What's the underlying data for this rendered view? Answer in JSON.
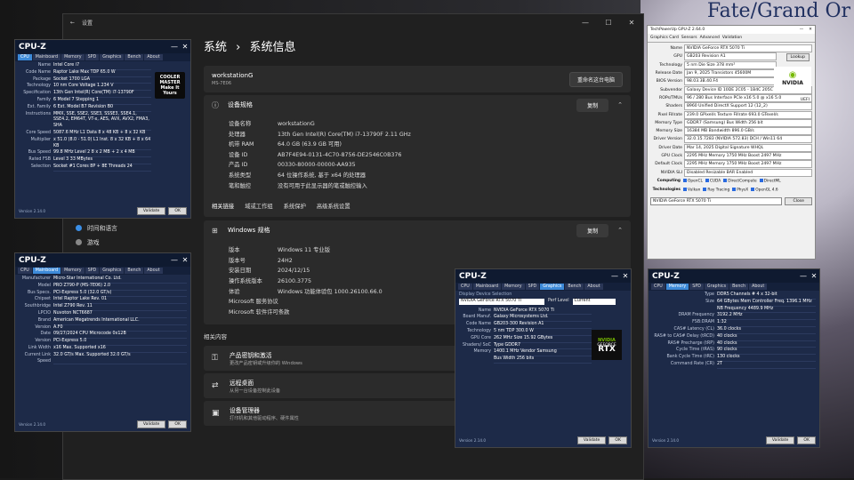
{
  "background": {
    "brand_text": "Fate/Grand Or"
  },
  "settings": {
    "window_title": "设置",
    "header": {
      "parent": "系统",
      "separator": "›",
      "current": "系统信息"
    },
    "device": {
      "name": "workstationG",
      "model": "MS-7E06",
      "rename_button": "重命名这台电脑"
    },
    "spec_section": {
      "title": "设备规格",
      "copy_button": "复制",
      "rows": [
        {
          "k": "设备名称",
          "v": "workstationG"
        },
        {
          "k": "处理器",
          "v": "13th Gen Intel(R) Core(TM) i7-13790F   2.11 GHz"
        },
        {
          "k": "机带 RAM",
          "v": "64.0 GB (63.9 GB 可用)"
        },
        {
          "k": "设备 ID",
          "v": "AB7F4E94-0131-4C70-8756-DE2546C0B376"
        },
        {
          "k": "产品 ID",
          "v": "00330-80000-00000-AA935"
        },
        {
          "k": "系统类型",
          "v": "64 位操作系统, 基于 x64 的处理器"
        },
        {
          "k": "笔和触控",
          "v": "没有可用于此显示器的笔或触控输入"
        }
      ],
      "related_links": [
        "相关链接",
        "域或工作组",
        "系统保护",
        "高级系统设置"
      ]
    },
    "windows_section": {
      "title": "Windows 规格",
      "copy_button": "复制",
      "rows": [
        {
          "k": "版本",
          "v": "Windows 11 专业版"
        },
        {
          "k": "版本号",
          "v": "24H2"
        },
        {
          "k": "安装日期",
          "v": "2024/12/15"
        },
        {
          "k": "操作系统版本",
          "v": "26100.3775"
        },
        {
          "k": "体验",
          "v": "Windows 功能体验包 1000.26100.66.0"
        }
      ],
      "links": [
        "Microsoft 服务协议",
        "Microsoft 软件许可条款"
      ]
    },
    "related_title": "相关内容",
    "related_items": [
      {
        "title": "产品密钥和激活",
        "desc": "更改产品密钥或升级你的 Windows"
      },
      {
        "title": "远程桌面",
        "desc": "从另一台设备控制此设备"
      },
      {
        "title": "设备管理器",
        "desc": "打印机和其他驱动程序、硬件属性"
      }
    ],
    "sidebar_visible": [
      "时间和语言",
      "游戏"
    ]
  },
  "cpuz_cpu": {
    "title": "CPU-Z",
    "tabs": [
      "CPU",
      "Mainboard",
      "Memory",
      "SPD",
      "Graphics",
      "Bench",
      "About"
    ],
    "active_tab": "CPU",
    "logo_text": "COOLER MASTER Make It Yours",
    "rows": [
      {
        "k": "Name",
        "v": "Intel Core i7"
      },
      {
        "k": "Code Name",
        "v": "Raptor Lake    Max TDP  65.0 W"
      },
      {
        "k": "Package",
        "v": "Socket 1700 LGA"
      },
      {
        "k": "Technology",
        "v": "10 nm    Core Voltage  1.234 V"
      },
      {
        "k": "Specification",
        "v": "13th Gen Intel(R) Core(TM) i7-13790F"
      },
      {
        "k": "Family",
        "v": "6    Model 7    Stepping 1"
      },
      {
        "k": "Ext. Family",
        "v": "6    Ext. Model B7    Revision B0"
      },
      {
        "k": "Instructions",
        "v": "MMX, SSE, SSE2, SSE3, SSSE3, SSE4.1, SSE4.2, EM64T, VT-x, AES, AVX, AVX2, FMA3, SHA"
      },
      {
        "k": "Core Speed",
        "v": "5087.6 MHz   L1 Data 8 x 48 KB + 8 x 32 KB"
      },
      {
        "k": "Multiplier",
        "v": "x 51.0 (8.0 - 51.0)   L1 Inst. 8 x 32 KB + 8 x 64 KB"
      },
      {
        "k": "Bus Speed",
        "v": "99.8 MHz   Level 2  8 x 2 MB + 2 x 4 MB"
      },
      {
        "k": "Rated FSB",
        "v": "Level 3  33 MBytes"
      },
      {
        "k": "Selection",
        "v": "Socket #1   Cores 8P + 8E   Threads 24"
      }
    ],
    "version": "Version 2.14.0",
    "validate": "Validate",
    "ok": "OK"
  },
  "cpuz_mainboard": {
    "title": "CPU-Z",
    "tabs": [
      "CPU",
      "Mainboard",
      "Memory",
      "SPD",
      "Graphics",
      "Bench",
      "About"
    ],
    "active_tab": "Mainboard",
    "rows": [
      {
        "k": "Manufacturer",
        "v": "Micro-Star International Co. Ltd."
      },
      {
        "k": "Model",
        "v": "PRO Z790-P (MS-7E06)   2.0"
      },
      {
        "k": "Bus Specs.",
        "v": "PCI-Express 5.0 (32.0 GT/s)"
      },
      {
        "k": "Chipset",
        "v": "Intel   Raptor Lake   Rev. 01"
      },
      {
        "k": "Southbridge",
        "v": "Intel   Z790   Rev. 11"
      },
      {
        "k": "LPCIO",
        "v": "Nuvoton   NCT6687"
      },
      {
        "k": "Brand",
        "v": "American Megatrends International LLC."
      },
      {
        "k": "Version",
        "v": "A.F0"
      },
      {
        "k": "Date",
        "v": "09/27/2024   CPU Microcode 0x12B"
      },
      {
        "k": "Version",
        "v": "PCI-Express 5.0"
      },
      {
        "k": "Link Width",
        "v": "x16    Max. Supported x16"
      },
      {
        "k": "Current Link Speed",
        "v": "32.0 GT/s   Max. Supported 32.0 GT/s"
      }
    ],
    "version": "Version 2.14.0",
    "validate": "Validate",
    "ok": "OK"
  },
  "cpuz_graphics": {
    "title": "CPU-Z",
    "tabs": [
      "CPU",
      "Mainboard",
      "Memory",
      "SPD",
      "Graphics",
      "Bench",
      "About"
    ],
    "active_tab": "Graphics",
    "device_label": "Display Device Selection",
    "device_value": "NVIDIA GeForce RTX 5070 Ti",
    "perf_label": "Perf Level",
    "perf_value": "Current",
    "logo": {
      "brand": "NVIDIA",
      "line": "GEFORCE",
      "product": "RTX"
    },
    "rows": [
      {
        "k": "Name",
        "v": "NVIDIA GeForce RTX 5070 Ti"
      },
      {
        "k": "Board Manuf.",
        "v": "Galaxy Microsystems Ltd."
      },
      {
        "k": "Code Name",
        "v": "GB203-300   Revision A1"
      },
      {
        "k": "Technology",
        "v": "5 nm   TDP 300.0 W"
      },
      {
        "k": "GPU Core",
        "v": "262 MHz   Size 15.92 GBytes"
      },
      {
        "k": "Shaders/ SoC",
        "v": "Type GDDR7"
      },
      {
        "k": "Memory",
        "v": "1400.1 MHz   Vendor Samsung"
      },
      {
        "k": "",
        "v": "Bus Width 256 bits"
      }
    ],
    "version": "Version 2.14.0",
    "validate": "Validate",
    "ok": "OK"
  },
  "cpuz_memory": {
    "title": "CPU-Z",
    "tabs": [
      "CPU",
      "Memory",
      "SPD",
      "Graphics",
      "Bench",
      "About"
    ],
    "active_tab": "Memory",
    "rows": [
      {
        "k": "Type",
        "v": "DDR5   Channels # 4 x 32-bit"
      },
      {
        "k": "Size",
        "v": "64 GBytes   Mem Controller Freq. 1396.1 MHz"
      },
      {
        "k": "",
        "v": "NB Frequency 4489.9 MHz"
      },
      {
        "k": "DRAM Frequency",
        "v": "3192.2 MHz"
      },
      {
        "k": "FSB:DRAM",
        "v": "1:32"
      },
      {
        "k": "CAS# Latency (CL)",
        "v": "36.0 clocks"
      },
      {
        "k": "RAS# to CAS# Delay (tRCD)",
        "v": "40 clocks"
      },
      {
        "k": "RAS# Precharge (tRP)",
        "v": "40 clocks"
      },
      {
        "k": "Cycle Time (tRAS)",
        "v": "90 clocks"
      },
      {
        "k": "Bank Cycle Time (tRC)",
        "v": "130 clocks"
      },
      {
        "k": "Command Rate (CR)",
        "v": "2T"
      }
    ],
    "version": "Version 2.14.0",
    "validate": "Validate",
    "ok": "OK"
  },
  "gpuz": {
    "title": "TechPowerUp GPU-Z 2.64.0",
    "tabs": [
      "Graphics Card",
      "Sensors",
      "Advanced",
      "Validation"
    ],
    "lookup": "Lookup",
    "rows": [
      {
        "k": "Name",
        "v": "NVIDIA GeForce RTX 5070 Ti"
      },
      {
        "k": "GPU",
        "v": "GB203   Revision A1"
      },
      {
        "k": "Technology",
        "v": "5 nm   Die Size 378 mm²"
      },
      {
        "k": "Release Date",
        "v": "Jan 9, 2025   Transistors 45600M"
      },
      {
        "k": "BIOS Version",
        "v": "98.03.3B.40.F4"
      },
      {
        "k": "Subvendor",
        "v": "Galaxy   Device ID 10DE 2C05 - 1B4C 205C"
      },
      {
        "k": "ROPs/TMUs",
        "v": "96 / 280   Bus Interface PCIe x16 5.0 @ x16 5.0"
      },
      {
        "k": "Shaders",
        "v": "8960 Unified   DirectX Support 12 (12_2)"
      },
      {
        "k": "Pixel Fillrate",
        "v": "239.0 GPixel/s   Texture Fillrate 693.0 GTexel/s"
      },
      {
        "k": "Memory Type",
        "v": "GDDR7 (Samsung)   Bus Width 256 bit"
      },
      {
        "k": "Memory Size",
        "v": "16384 MB   Bandwidth 896.0 GB/s"
      },
      {
        "k": "Driver Version",
        "v": "32.0.15.7283 (NVIDIA 572.83) DCH / Win11 64"
      },
      {
        "k": "Driver Date",
        "v": "Mar 14, 2025   Digital Signature WHQL"
      },
      {
        "k": "GPU Clock",
        "v": "2295 MHz   Memory 1750 MHz   Boost 2497 MHz"
      },
      {
        "k": "Default Clock",
        "v": "2295 MHz   Memory 1750 MHz   Boost 2497 MHz"
      },
      {
        "k": "NVIDIA SLI",
        "v": "Disabled   Resizable BAR Enabled"
      }
    ],
    "computing": [
      "OpenCL",
      "CUDA",
      "DirectCompute",
      "DirectML"
    ],
    "technologies": [
      "Vulkan",
      "Ray Tracing",
      "PhysX",
      "OpenGL 4.6"
    ],
    "selected_card": "NVIDIA GeForce RTX 5070 Ti",
    "close": "Close",
    "logo": "NVIDIA",
    "uefi": "UEFI"
  }
}
